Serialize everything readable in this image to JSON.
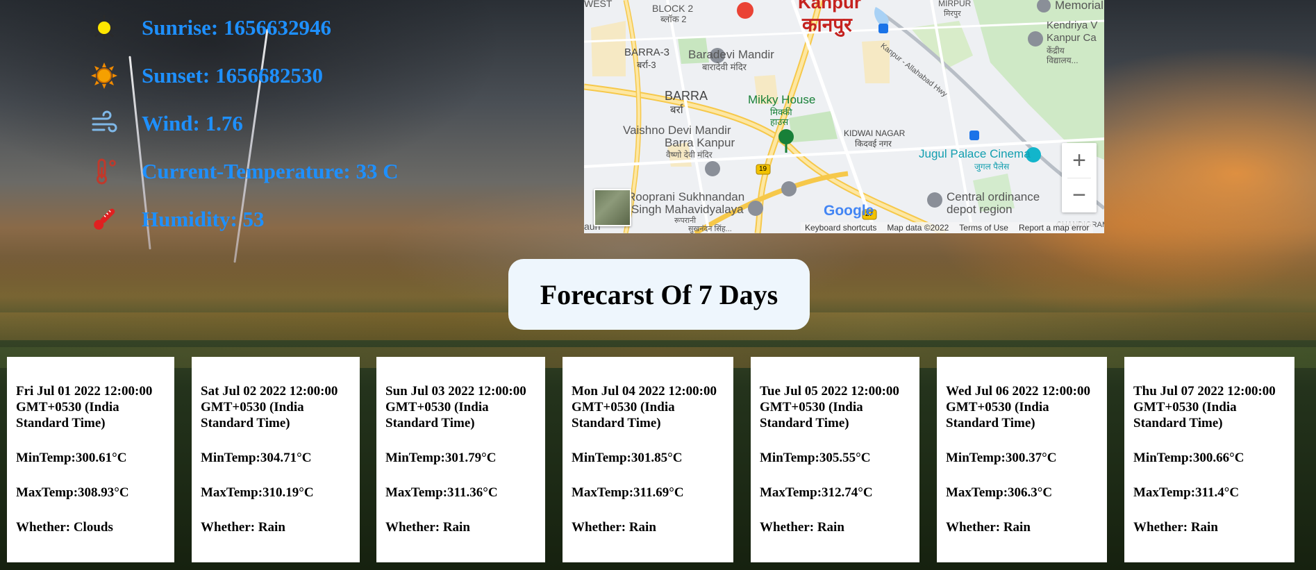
{
  "weather": {
    "sunrise": "Sunrise: 1656632946",
    "sunset": "Sunset: 1656682530",
    "wind": "Wind: 1.76",
    "temperature": "Current-Temperature: 33 C",
    "humidity": "Humidity: 53",
    "icons": [
      "sun-icon",
      "sunset-icon",
      "wind-icon",
      "thermometer-icon",
      "humidity-thermometer-icon"
    ]
  },
  "map": {
    "labels": {
      "west": "WEST",
      "block2": "BLOCK 2",
      "block2_hi": "ब्लॉक 2",
      "kanpur": "Kanpur",
      "kanpur_hi": "कानपुर",
      "mirpur": "MIRPUR",
      "mirpur_hi": "मिरपुर",
      "memorial": "Memorial Chu",
      "kendriya": "Kendriya V",
      "kendriya2": "Kanpur Ca",
      "kendriya_hi": "केंद्रीय",
      "kendriya_hi2": "विद्यालय...",
      "barra3": "BARRA-3",
      "barra3_hi": "बर्रा-3",
      "baradevi": "Baradevi Mandir",
      "baradevi_hi": "बारादेवी मंदिर",
      "highway": "Kanpur - Allahabad Hwy",
      "barra": "BARRA",
      "barra_hi": "बर्रा",
      "mikky": "Mikky House",
      "mikky_hi": "मिक्की",
      "mikky_hi2": "हाउस",
      "vaishno1": "Vaishno Devi Mandir",
      "vaishno2": "Barra Kanpur",
      "vaishno_hi": "वैष्णो देवी मंदिर",
      "kidwai": "KIDWAI NAGAR",
      "kidwai_hi": "किदवई नगर",
      "jugul": "Jugul Palace Cinema",
      "jugul_hi": "जुगल पैलेस",
      "roop1": "Rooprani Sukhnandan",
      "roop2": "Singh Mahavidyalaya",
      "roop_hi": "रूपरानी",
      "roop_hi2": "सुखनंदन सिंह...",
      "central1": "Central ordinance",
      "central2": "depot region",
      "chandigram": "CHANDIGRAM",
      "saun": "aun",
      "road19": "19",
      "road27": "27",
      "google": "Google"
    },
    "zoom_in": "+",
    "zoom_out": "−",
    "footer": {
      "shortcuts": "Keyboard shortcuts",
      "data": "Map data ©2022",
      "terms": "Terms of Use",
      "report": "Report a map error"
    }
  },
  "forecast": {
    "title": "Forecarst Of 7 Days",
    "days": [
      {
        "date": "Fri Jul 01 2022 12:00:00 GMT+0530 (India Standard Time)",
        "min": "MinTemp:300.61°C",
        "max": "MaxTemp:308.93°C",
        "weather": "Whether: Clouds"
      },
      {
        "date": "Sat Jul 02 2022 12:00:00 GMT+0530 (India Standard Time)",
        "min": "MinTemp:304.71°C",
        "max": "MaxTemp:310.19°C",
        "weather": "Whether: Rain"
      },
      {
        "date": "Sun Jul 03 2022 12:00:00 GMT+0530 (India Standard Time)",
        "min": "MinTemp:301.79°C",
        "max": "MaxTemp:311.36°C",
        "weather": "Whether: Rain"
      },
      {
        "date": "Mon Jul 04 2022 12:00:00 GMT+0530 (India Standard Time)",
        "min": "MinTemp:301.85°C",
        "max": "MaxTemp:311.69°C",
        "weather": "Whether: Rain"
      },
      {
        "date": "Tue Jul 05 2022 12:00:00 GMT+0530 (India Standard Time)",
        "min": "MinTemp:305.55°C",
        "max": "MaxTemp:312.74°C",
        "weather": "Whether: Rain"
      },
      {
        "date": "Wed Jul 06 2022 12:00:00 GMT+0530 (India Standard Time)",
        "min": "MinTemp:300.37°C",
        "max": "MaxTemp:306.3°C",
        "weather": "Whether: Rain"
      },
      {
        "date": "Thu Jul 07 2022 12:00:00 GMT+0530 (India Standard Time)",
        "min": "MinTemp:300.66°C",
        "max": "MaxTemp:311.4°C",
        "weather": "Whether: Rain"
      }
    ]
  },
  "colors": {
    "info_text": "#1e90ff",
    "map_red_label": "#c5221f",
    "card_bg": "#ffffff",
    "title_box_bg": "#eef6fd"
  }
}
